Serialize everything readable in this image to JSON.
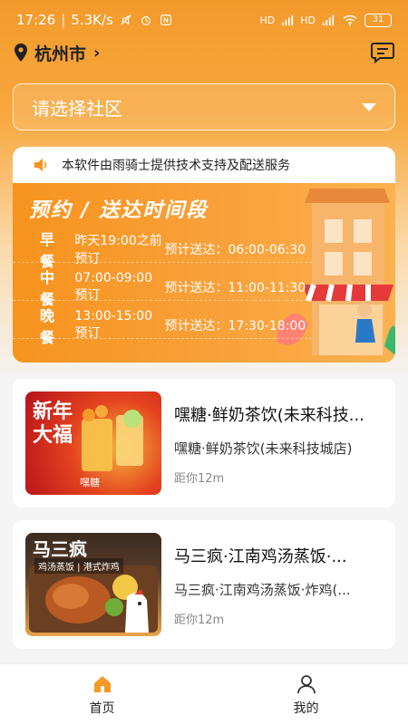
{
  "status_bar": {
    "time": "17:26",
    "speed": "5.3K/s",
    "battery": "31",
    "signal_label_1": "HD",
    "signal_label_2": "HD"
  },
  "header": {
    "city": "杭州市",
    "icons": [
      "location-pin-icon",
      "chevron-right-icon",
      "message-icon"
    ]
  },
  "community": {
    "placeholder": "请选择社区"
  },
  "notice": {
    "text": "本软件由雨骑士提供技术支持及配送服务"
  },
  "schedule": {
    "title": "预约 / 送达时间段",
    "rows": [
      {
        "meal": "早餐",
        "order": "昨天19:00之前预订",
        "deliver": "预计送达：06:00-06:30"
      },
      {
        "meal": "中餐",
        "order": "07:00-09:00预订",
        "deliver": "预计送达：11:00-11:30"
      },
      {
        "meal": "晚餐",
        "order": "13:00-15:00预订",
        "deliver": "预计送达：17:30-18:00"
      }
    ]
  },
  "stores": [
    {
      "name": "嘿糖·鲜奶茶饮(未来科技...",
      "subtitle": "嘿糖·鲜奶茶饮(未来科技城店)",
      "distance": "距你12m",
      "image_caption": "新年 大福",
      "image_label": "嘿糖"
    },
    {
      "name": "马三疯·江南鸡汤蒸饭·...",
      "subtitle": "马三疯·江南鸡汤蒸饭·炸鸡(...",
      "distance": "距你12m",
      "image_caption": "马三疯",
      "image_label": "鸡汤蒸饭 | 港式炸鸡"
    }
  ],
  "tabs": [
    {
      "label": "首页",
      "icon": "home-icon",
      "active": true
    },
    {
      "label": "我的",
      "icon": "user-icon",
      "active": false
    }
  ],
  "colors": {
    "accent": "#f7931e",
    "tab_active_icon": "#f59a23"
  }
}
